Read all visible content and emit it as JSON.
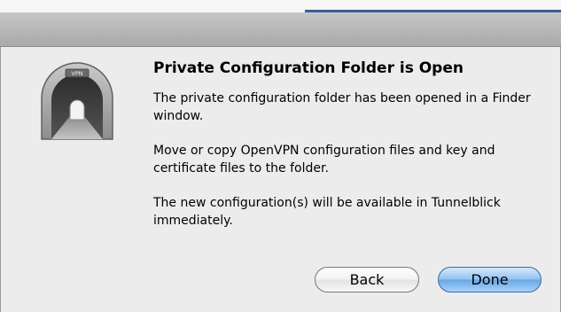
{
  "dialog": {
    "icon": "tunnelblick-tunnel-icon",
    "icon_sign_text": "VPN",
    "title": "Private Configuration Folder is Open",
    "paragraphs": [
      "The private configuration folder has been opened in a Finder window.",
      "Move or copy OpenVPN configuration files and key and certificate files to the folder.",
      "The new configuration(s) will be available in Tunnelblick immediately."
    ],
    "buttons": {
      "back_label": "Back",
      "done_label": "Done"
    }
  },
  "colors": {
    "default_button": "#6aa7e6",
    "window_background": "#ececec"
  }
}
